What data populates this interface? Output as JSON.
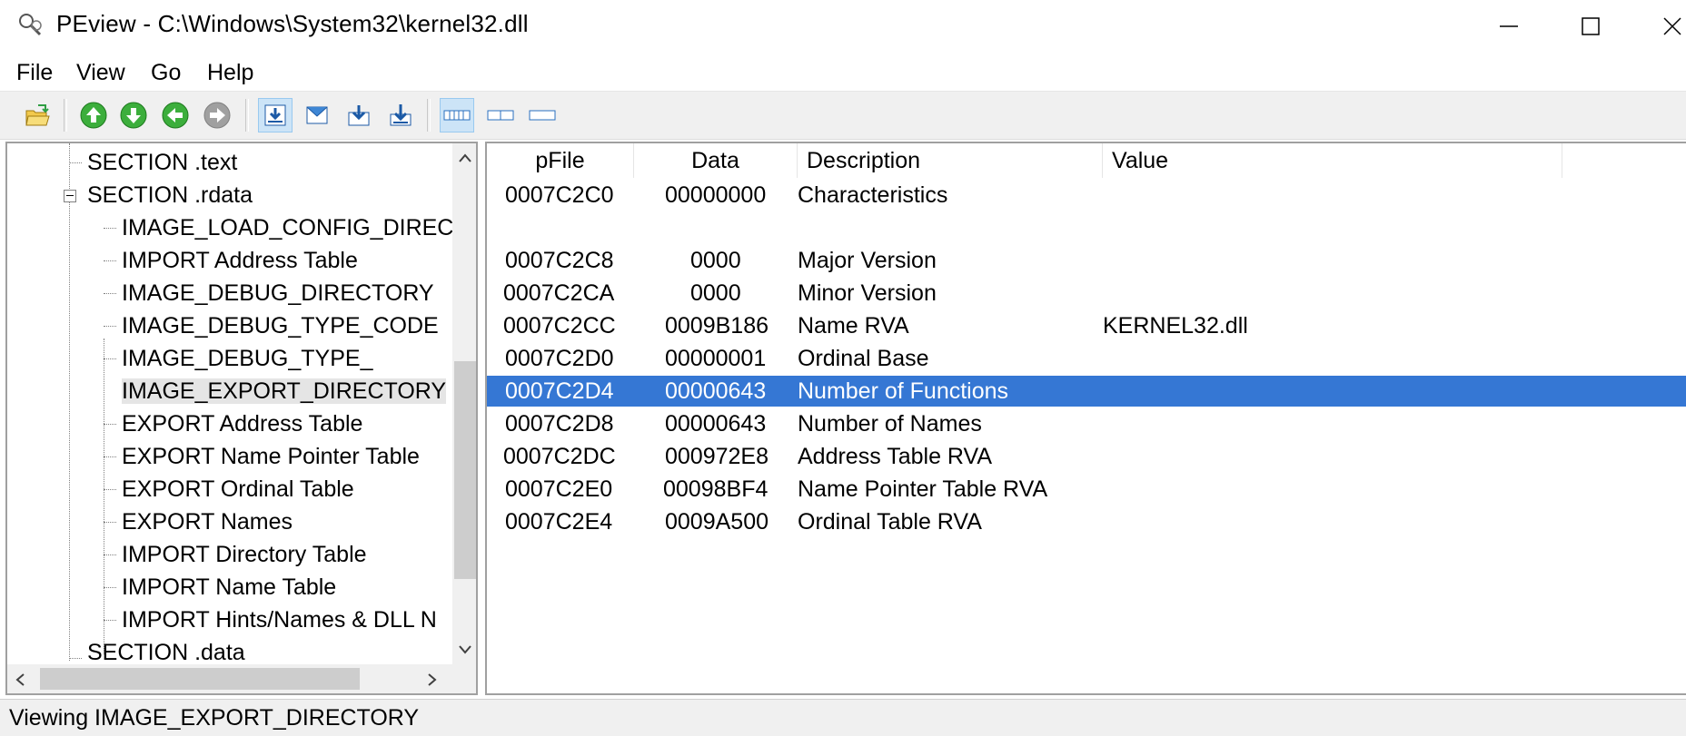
{
  "window": {
    "title": "PEview - C:\\Windows\\System32\\kernel32.dll",
    "icon": "magnifier-icon"
  },
  "menu": [
    "File",
    "View",
    "Go",
    "Help"
  ],
  "toolbar": {
    "buttons": [
      {
        "name": "open-file-icon"
      },
      {
        "name": "up-arrow-icon",
        "color": "#3cae3c"
      },
      {
        "name": "down-arrow-icon",
        "color": "#3cae3c"
      },
      {
        "name": "back-arrow-icon",
        "color": "#3cae3c"
      },
      {
        "name": "forward-arrow-icon",
        "color": "#a0a0a0"
      },
      {
        "name": "view-section-icon",
        "pressed": true
      },
      {
        "name": "view-header-icon"
      },
      {
        "name": "view-down-icon"
      },
      {
        "name": "view-bottom-icon"
      },
      {
        "name": "byte-view-icon",
        "pressed": true
      },
      {
        "name": "word-view-icon"
      },
      {
        "name": "dword-view-icon"
      }
    ]
  },
  "tree": {
    "items": [
      {
        "label": "SECTION .text"
      },
      {
        "label": "SECTION .rdata",
        "expanded": true
      },
      {
        "label": "IMAGE_LOAD_CONFIG_DIREC"
      },
      {
        "label": "IMPORT Address Table"
      },
      {
        "label": "IMAGE_DEBUG_DIRECTORY"
      },
      {
        "label": "IMAGE_DEBUG_TYPE_CODE"
      },
      {
        "label": "IMAGE_DEBUG_TYPE_"
      },
      {
        "label": "IMAGE_EXPORT_DIRECTORY",
        "selected": true
      },
      {
        "label": "EXPORT Address Table"
      },
      {
        "label": "EXPORT Name Pointer Table"
      },
      {
        "label": "EXPORT Ordinal Table"
      },
      {
        "label": "EXPORT Names"
      },
      {
        "label": "IMPORT Directory Table"
      },
      {
        "label": "IMPORT Name Table"
      },
      {
        "label": "IMPORT Hints/Names & DLL N"
      },
      {
        "label": "SECTION .data"
      }
    ]
  },
  "table": {
    "columns": [
      "pFile",
      "Data",
      "Description",
      "Value"
    ],
    "rows": [
      {
        "pFile": "0007C2C0",
        "data": "00000000",
        "description": "Characteristics",
        "value": ""
      },
      {
        "pFile": "",
        "data": "",
        "description": "",
        "value": ""
      },
      {
        "pFile": "0007C2C8",
        "data": "0000",
        "description": "Major Version",
        "value": ""
      },
      {
        "pFile": "0007C2CA",
        "data": "0000",
        "description": "Minor Version",
        "value": ""
      },
      {
        "pFile": "0007C2CC",
        "data": "0009B186",
        "description": "Name RVA",
        "value": "KERNEL32.dll"
      },
      {
        "pFile": "0007C2D0",
        "data": "00000001",
        "description": "Ordinal Base",
        "value": ""
      },
      {
        "pFile": "0007C2D4",
        "data": "00000643",
        "description": "Number of Functions",
        "value": "",
        "selected": true
      },
      {
        "pFile": "0007C2D8",
        "data": "00000643",
        "description": "Number of Names",
        "value": ""
      },
      {
        "pFile": "0007C2DC",
        "data": "000972E8",
        "description": "Address Table RVA",
        "value": ""
      },
      {
        "pFile": "0007C2E0",
        "data": "00098BF4",
        "description": "Name Pointer Table RVA",
        "value": ""
      },
      {
        "pFile": "0007C2E4",
        "data": "0009A500",
        "description": "Ordinal Table RVA",
        "value": ""
      }
    ]
  },
  "status": {
    "text": "Viewing IMAGE_EXPORT_DIRECTORY"
  },
  "colors": {
    "selection": "#3577d4",
    "toolbar_bg": "#f0f0f0"
  }
}
